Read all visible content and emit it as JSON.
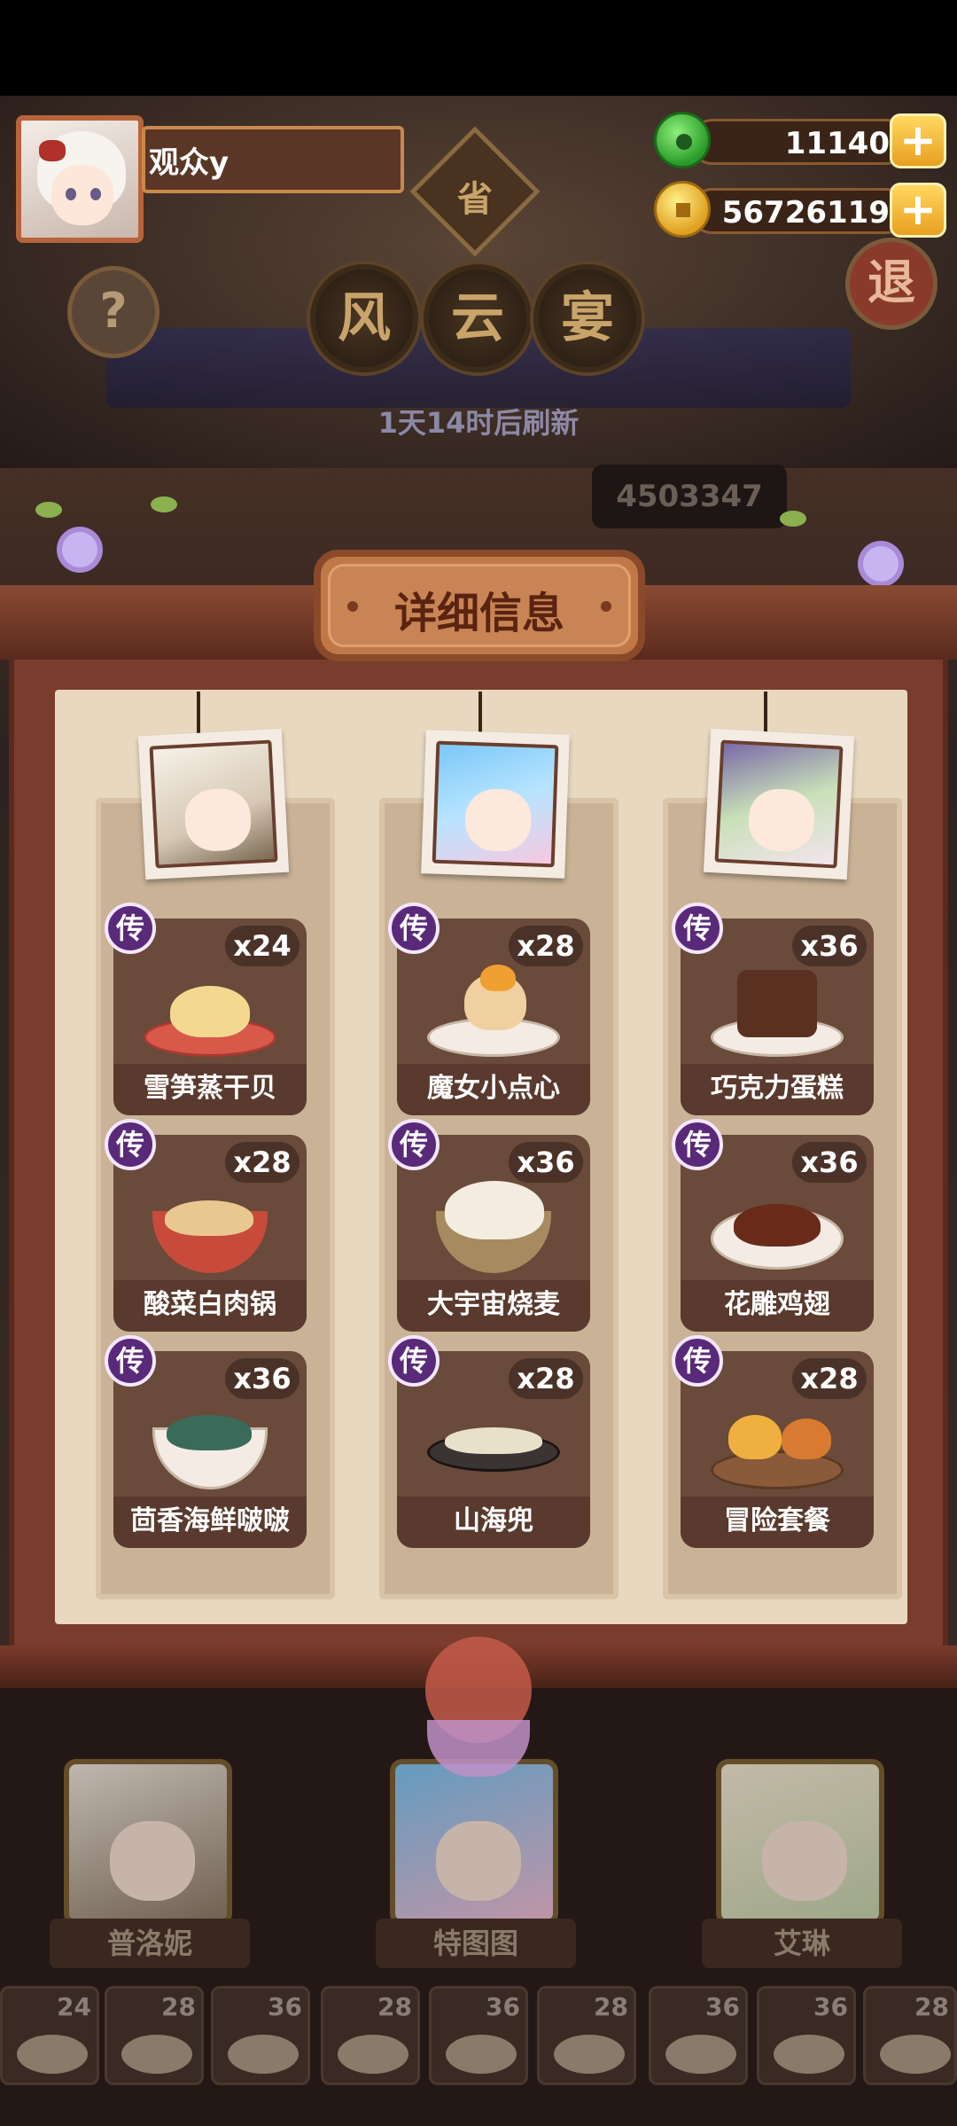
{
  "player": {
    "name": "观众y"
  },
  "currency": [
    {
      "icon": "jade-icon",
      "value": "11140"
    },
    {
      "icon": "gold-coin-icon",
      "value": "56726119"
    }
  ],
  "plus_label": "+",
  "header": {
    "badge": "省",
    "plaques": [
      "风",
      "云",
      "宴"
    ],
    "help_label": "?",
    "exit_label": "退",
    "refresh_text": "1天14时后刷新",
    "score": "4503347"
  },
  "panel": {
    "title": "详细信息",
    "rarity_badge": "传",
    "columns": [
      {
        "dishes": [
          {
            "name": "雪笋蒸干贝",
            "count": "x24"
          },
          {
            "name": "酸菜白肉锅",
            "count": "x28"
          },
          {
            "name": "茴香海鲜啵啵",
            "count": "x36"
          }
        ]
      },
      {
        "dishes": [
          {
            "name": "魔女小点心",
            "count": "x28"
          },
          {
            "name": "大宇宙烧麦",
            "count": "x36"
          },
          {
            "name": "山海兜",
            "count": "x28"
          }
        ]
      },
      {
        "dishes": [
          {
            "name": "巧克力蛋糕",
            "count": "x36"
          },
          {
            "name": "花雕鸡翅",
            "count": "x36"
          },
          {
            "name": "冒险套餐",
            "count": "x28"
          }
        ]
      }
    ]
  },
  "heroes": [
    {
      "name": "普洛妮"
    },
    {
      "name": "特图图"
    },
    {
      "name": "艾琳"
    }
  ],
  "dish_strip": [
    "24",
    "28",
    "36",
    "28",
    "36",
    "28",
    "36",
    "36",
    "28"
  ]
}
